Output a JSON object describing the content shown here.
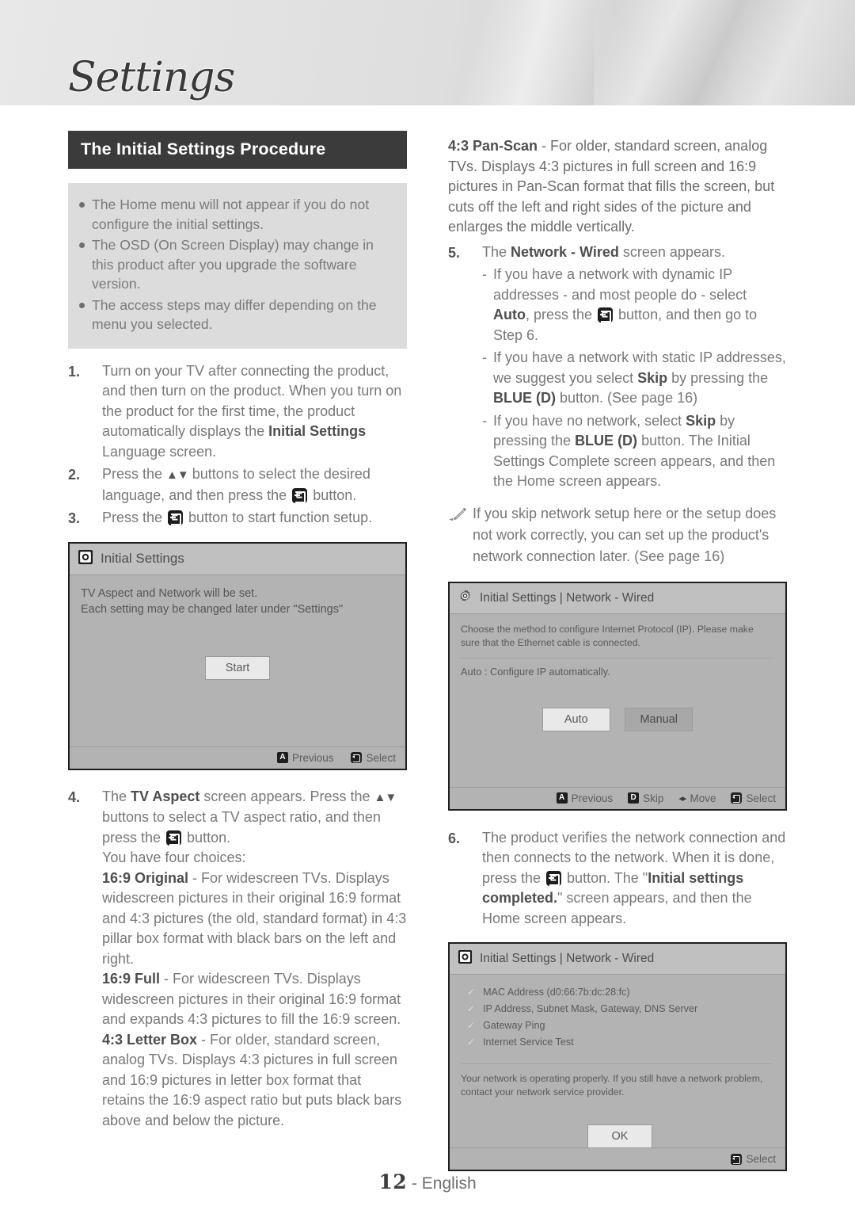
{
  "banner": {
    "title": "Settings"
  },
  "section": {
    "heading": "The Initial Settings Procedure"
  },
  "notes": [
    "The Home menu will not appear if you do not configure the initial settings.",
    "The OSD (On Screen Display) may change in this product after you upgrade the software version.",
    "The access steps may differ depending on the menu you selected."
  ],
  "steps": {
    "s1_num": "1.",
    "s1_a": "Turn on your TV after connecting the product, and then turn on the product. When you turn on the product for the first time, the product automatically displays the ",
    "s1_b": "Initial Settings",
    "s1_c": " Language screen.",
    "s2_num": "2.",
    "s2_a": "Press the ",
    "s2_arrows": "▲▼",
    "s2_b": " buttons to select the desired language, and then press the ",
    "s2_c": " button.",
    "s3_num": "3.",
    "s3_a": "Press the ",
    "s3_b": " button to start function setup.",
    "s4_num": "4.",
    "s4_a": "The ",
    "s4_b": "TV Aspect",
    "s4_c": " screen appears. Press the ",
    "s4_arrows": "▲▼",
    "s4_d": " buttons to select a TV aspect ratio, and then press the ",
    "s4_e": " button.",
    "s4_f": "You have four choices:",
    "opt1_label": "16:9 Original",
    "opt1_text": " - For widescreen TVs. Displays widescreen pictures in their original 16:9 format and 4:3 pictures (the old, standard format) in 4:3 pillar box format with black bars on the left and right.",
    "opt2_label": "16:9 Full",
    "opt2_text": " - For widescreen TVs. Displays widescreen pictures in their original 16:9 format and expands 4:3 pictures to fill the 16:9 screen.",
    "opt3_label": "4:3 Letter Box",
    "opt3_text": " - For older, standard screen, analog TVs. Displays 4:3 pictures in full screen and 16:9 pictures in letter box format that retains the 16:9 aspect ratio but puts black bars above and below the picture.",
    "opt4_label": "4:3 Pan-Scan",
    "opt4_text": " - For older, standard screen, analog TVs. Displays 4:3 pictures in full screen and 16:9 pictures in Pan-Scan format that fills the screen, but cuts off the left and right sides of the picture and enlarges the middle vertically.",
    "s5_num": "5.",
    "s5_a": "The ",
    "s5_b": "Network - Wired",
    "s5_c": " screen appears.",
    "s5_sub1_a": "If you have a network with dynamic IP addresses - and most people do - select ",
    "s5_sub1_b": "Auto",
    "s5_sub1_c": ", press the ",
    "s5_sub1_d": " button, and then go to Step 6.",
    "s5_sub2_a": "If you have a network with static IP addresses, we suggest you select ",
    "s5_sub2_b": "Skip",
    "s5_sub2_c": " by pressing the ",
    "s5_sub2_d": "BLUE (D)",
    "s5_sub2_e": " button. (See page 16)",
    "s5_sub3_a": "If you have no network, select ",
    "s5_sub3_b": "Skip",
    "s5_sub3_c": " by pressing the ",
    "s5_sub3_d": "BLUE (D)",
    "s5_sub3_e": " button. The Initial Settings Complete screen appears, and then the Home screen appears.",
    "s6_num": "6.",
    "s6_a": "The product verifies the network connection and then connects to the network. When it is done, press the ",
    "s6_b": " button. The \"",
    "s6_c": "Initial settings completed.",
    "s6_d": "\" screen appears, and then the Home screen appears."
  },
  "pencil_note": "If you skip network setup here or the setup does not work correctly, you can set up the product's network connection later. (See page 16)",
  "screens": {
    "initial_settings": {
      "title": "Initial Settings",
      "line1": "TV Aspect and Network will be set.",
      "line2": "Each setting may be changed later under \"Settings\"",
      "start_button": "Start",
      "footer": [
        {
          "key": "A",
          "label": "Previous"
        },
        {
          "key": "enter",
          "label": "Select"
        }
      ]
    },
    "network_wired_config": {
      "title": "Initial Settings | Network - Wired",
      "desc": "Choose the method to configure Internet Protocol (IP). Please make sure that the Ethernet cable is connected.",
      "auto_desc": "Auto : Configure IP automatically.",
      "auto_button": "Auto",
      "manual_button": "Manual",
      "footer": [
        {
          "key": "A",
          "label": "Previous"
        },
        {
          "key": "D",
          "label": "Skip"
        },
        {
          "key": "move",
          "label": "Move"
        },
        {
          "key": "enter",
          "label": "Select"
        }
      ]
    },
    "network_wired_result": {
      "title": "Initial Settings | Network - Wired",
      "checks": [
        "MAC Address (d0:66:7b:dc:28:fc)",
        "IP Address, Subnet Mask, Gateway, DNS Server",
        "Gateway Ping",
        "Internet Service Test"
      ],
      "status": "Your network is operating properly. If you still have a network problem, contact your network service provider.",
      "ok_button": "OK",
      "footer": [
        {
          "key": "enter",
          "label": "Select"
        }
      ]
    }
  },
  "page_footer": {
    "number": "12",
    "sep": " - ",
    "language": "English"
  }
}
